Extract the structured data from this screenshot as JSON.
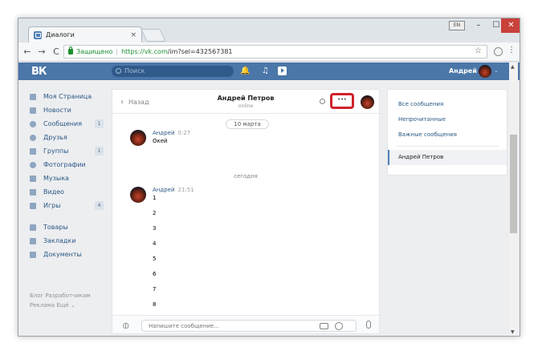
{
  "browser": {
    "tab_title": "Диалоги",
    "tab_close": "×",
    "lang_indicator": "EN",
    "win_min": "–",
    "win_max": "☐",
    "win_close": "✕",
    "secure_label": "Защищено",
    "url_scheme_host": "https://vk.com",
    "url_path": "/im?sel=432567381",
    "back": "←",
    "forward": "→",
    "reload": "C",
    "bookmark": "☆",
    "menu": "⋮"
  },
  "header": {
    "logo": "ВК",
    "search_placeholder": "Поиск",
    "user_name": "Андрей",
    "bell": "🔔",
    "music": "♫"
  },
  "left_nav": {
    "items": [
      {
        "label": "Моя Страница",
        "badge": ""
      },
      {
        "label": "Новости",
        "badge": ""
      },
      {
        "label": "Сообщения",
        "badge": "1"
      },
      {
        "label": "Друзья",
        "badge": ""
      },
      {
        "label": "Группы",
        "badge": "1"
      },
      {
        "label": "Фотографии",
        "badge": ""
      },
      {
        "label": "Музыка",
        "badge": ""
      },
      {
        "label": "Видео",
        "badge": ""
      },
      {
        "label": "Игры",
        "badge": "4"
      }
    ],
    "items2": [
      {
        "label": "Товары"
      },
      {
        "label": "Закладки"
      },
      {
        "label": "Документы"
      }
    ],
    "footer_line1": "Блог  Разработчикам",
    "footer_line2": "Реклама  Ещё ⌄"
  },
  "chat": {
    "back_label": "Назад",
    "peer_name": "Андрей Петров",
    "peer_status": "online",
    "more_label": "···",
    "date_label": "10 марта",
    "today_label": "сегодня",
    "messages": [
      {
        "author": "Андрей",
        "time": "0:27",
        "lines": [
          "Окей"
        ]
      },
      {
        "author": "Андрей",
        "time": "21:51",
        "lines": [
          "1",
          "2",
          "3",
          "4",
          "5",
          "6",
          "7",
          "8"
        ]
      }
    ],
    "input_placeholder": "Напишите сообщение..."
  },
  "right_panel": {
    "items": [
      "Все сообщения",
      "Непрочитанные",
      "Важные сообщения"
    ],
    "active": "Андрей Петров"
  }
}
